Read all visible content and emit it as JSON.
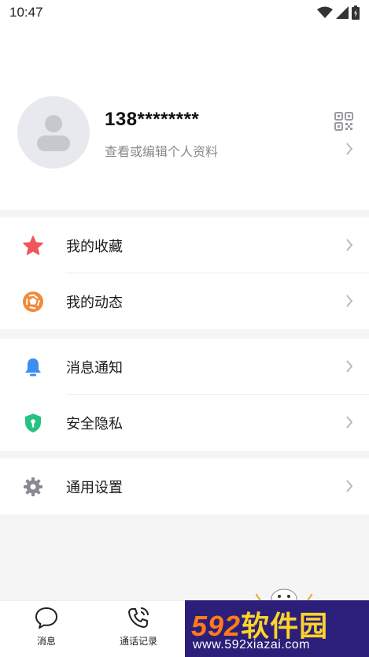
{
  "status_bar": {
    "time": "10:47"
  },
  "profile": {
    "phone": "138********",
    "subtitle": "查看或编辑个人资料"
  },
  "menu_groups": [
    {
      "items": [
        {
          "label": "我的收藏",
          "icon": "star-icon",
          "color": "#f0565c"
        },
        {
          "label": "我的动态",
          "icon": "aperture-icon",
          "color": "#f08a3c"
        }
      ]
    },
    {
      "items": [
        {
          "label": "消息通知",
          "icon": "bell-icon",
          "color": "#3d8ef0"
        },
        {
          "label": "安全隐私",
          "icon": "shield-icon",
          "color": "#26c281"
        }
      ]
    },
    {
      "items": [
        {
          "label": "通用设置",
          "icon": "gear-icon",
          "color": "#8a8a94"
        }
      ]
    }
  ],
  "bottom_nav": [
    {
      "label": "消息",
      "icon": "chat-bubble-icon"
    },
    {
      "label": "通话记录",
      "icon": "phone-call-icon"
    }
  ],
  "watermark": {
    "number": "592",
    "text": "软件园",
    "url": "www.592xiazai.com"
  }
}
